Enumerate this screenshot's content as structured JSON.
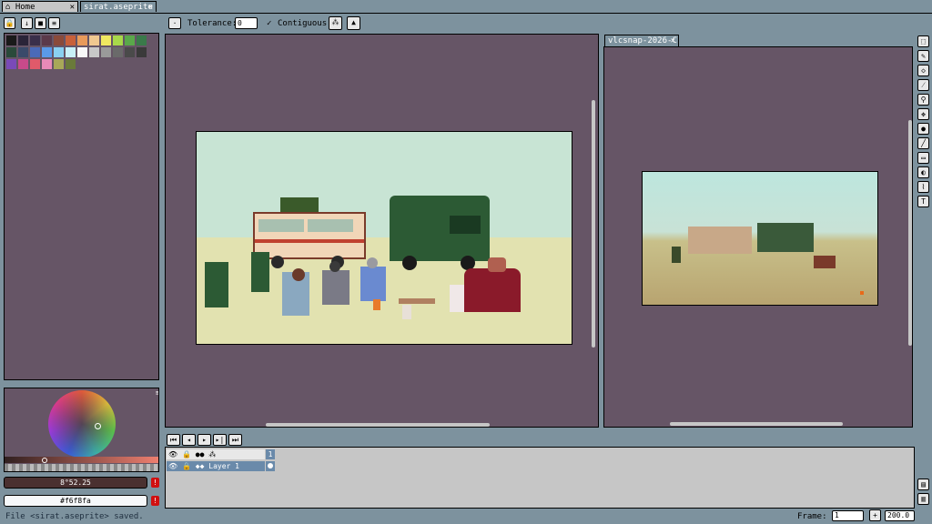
{
  "tabs": [
    {
      "label": "Home",
      "close": "✕"
    },
    {
      "label": "sirat.aseprite",
      "close": "✕"
    }
  ],
  "toolbar": {
    "tolerance_label": "Tolerance:",
    "tolerance_value": "0",
    "contiguous_label": "Contiguous",
    "contiguous_check": "✓"
  },
  "reference_tab": {
    "label": "vlcsnap-2026-C",
    "close": "✕"
  },
  "palette": {
    "colors": [
      "#1a1a1a",
      "#2a2438",
      "#3a2f4a",
      "#5b3a4a",
      "#8a4a3a",
      "#c8603a",
      "#e89a5a",
      "#f0c890",
      "#f0e860",
      "#a8d84a",
      "#5aa84a",
      "#3a7a4a",
      "#2a4a3a",
      "#3a4a6a",
      "#4a6ab8",
      "#5a9ae8",
      "#8ad0f0",
      "#c8f0f8",
      "#f8f8f8",
      "#c8c8c8",
      "#9a9a9a",
      "#6a6a6a",
      "#4a4a4a",
      "#3a3a3a",
      "#7a4ab8",
      "#c84a8a",
      "#e05a6a",
      "#e88ab8",
      "#a8a858",
      "#6a7a3a"
    ]
  },
  "color_fields": {
    "primary_value": "8°52.25",
    "secondary_value": "#f6f8fa",
    "primary_color": "#4a3030",
    "secondary_color": "#f6f8fa",
    "warn_glyph": "!"
  },
  "timeline": {
    "frame_number": "1",
    "layer_name": "Layer 1"
  },
  "status": {
    "message": "File <sirat.aseprite> saved.",
    "frame_label": "Frame:",
    "frame_value": "1",
    "zoom_value": "200.0"
  },
  "colors": {
    "workspace": "#7d929e",
    "editor_bg": "#665566",
    "sky": "#c8e4d4",
    "sand": "#e2e2b0"
  }
}
